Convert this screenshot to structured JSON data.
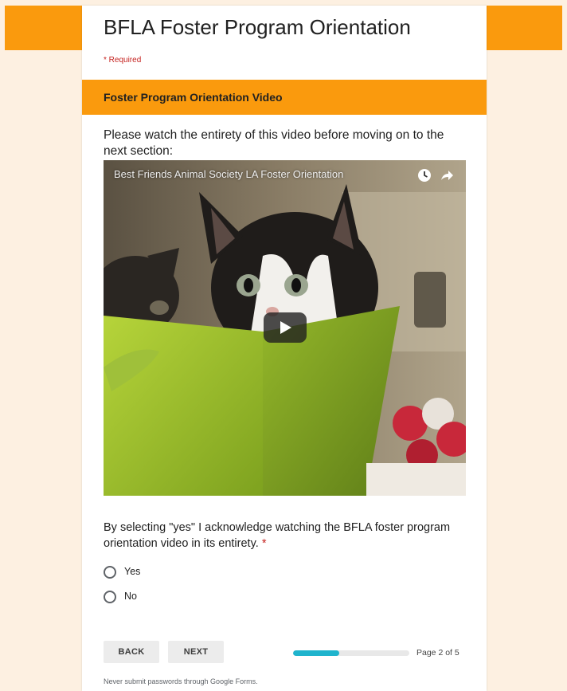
{
  "form": {
    "title": "BFLA Foster Program Orientation",
    "required_note": "* Required"
  },
  "section": {
    "header": "Foster Program Orientation Video",
    "instructions": "Please watch the entirety of this video before moving on to the next section:"
  },
  "video": {
    "title": "Best Friends Animal Society LA Foster Orientation",
    "icons": [
      "watch-later-icon",
      "share-icon",
      "play-icon"
    ]
  },
  "question": {
    "text": "By selecting \"yes\" I acknowledge watching the BFLA foster program orientation video in its entirety.",
    "required_marker": "*",
    "options": [
      {
        "label": "Yes",
        "selected": false
      },
      {
        "label": "No",
        "selected": false
      }
    ]
  },
  "navigation": {
    "back_label": "BACK",
    "next_label": "NEXT",
    "page_label": "Page 2 of 5",
    "current_page": 2,
    "total_pages": 5,
    "progress": 0.4
  },
  "footer": {
    "note": "Never submit passwords through Google Forms."
  },
  "colors": {
    "accent": "#fa9a0d",
    "background": "#fdf0e1",
    "progress": "#1fb4cd",
    "required": "#c5221f"
  }
}
